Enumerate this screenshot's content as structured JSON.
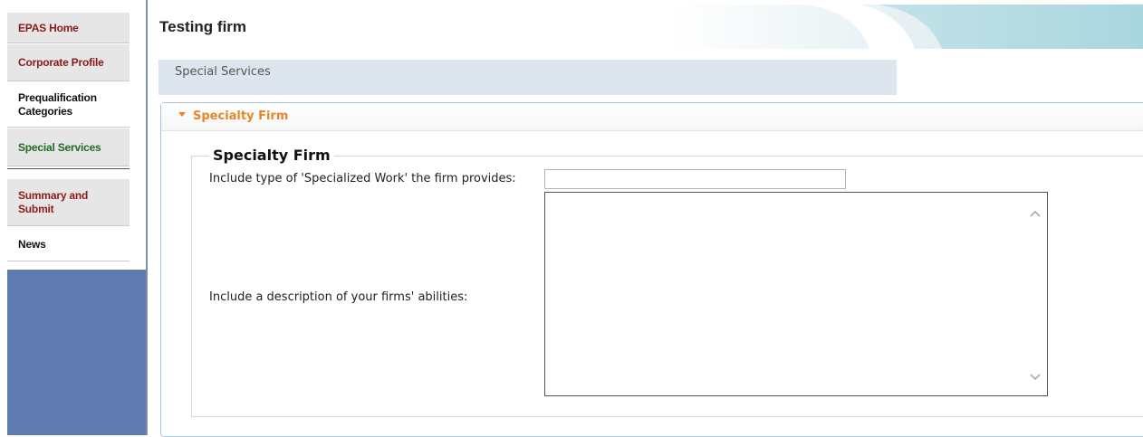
{
  "sidebar": {
    "items": [
      {
        "label": "EPAS Home"
      },
      {
        "label": "Corporate Profile"
      },
      {
        "label": "Prequalification Categories"
      },
      {
        "label": "Special Services"
      },
      {
        "label": "Summary and Submit"
      },
      {
        "label": "News"
      }
    ]
  },
  "header": {
    "title": "Testing firm"
  },
  "subbar": {
    "label": "Special Services"
  },
  "panel": {
    "title": "Specialty Firm",
    "legend": "Specialty Firm",
    "fields": {
      "work_label": "Include type of 'Specialized Work' the firm provides:",
      "work_value": "",
      "abilities_label": "Include a description of your firms' abilities:",
      "abilities_value": ""
    }
  },
  "colors": {
    "sidebar_block": "#5e7aaf",
    "accent_orange": "#e8852a",
    "link_red": "#8b1a1a",
    "link_green": "#1e6b1e"
  }
}
